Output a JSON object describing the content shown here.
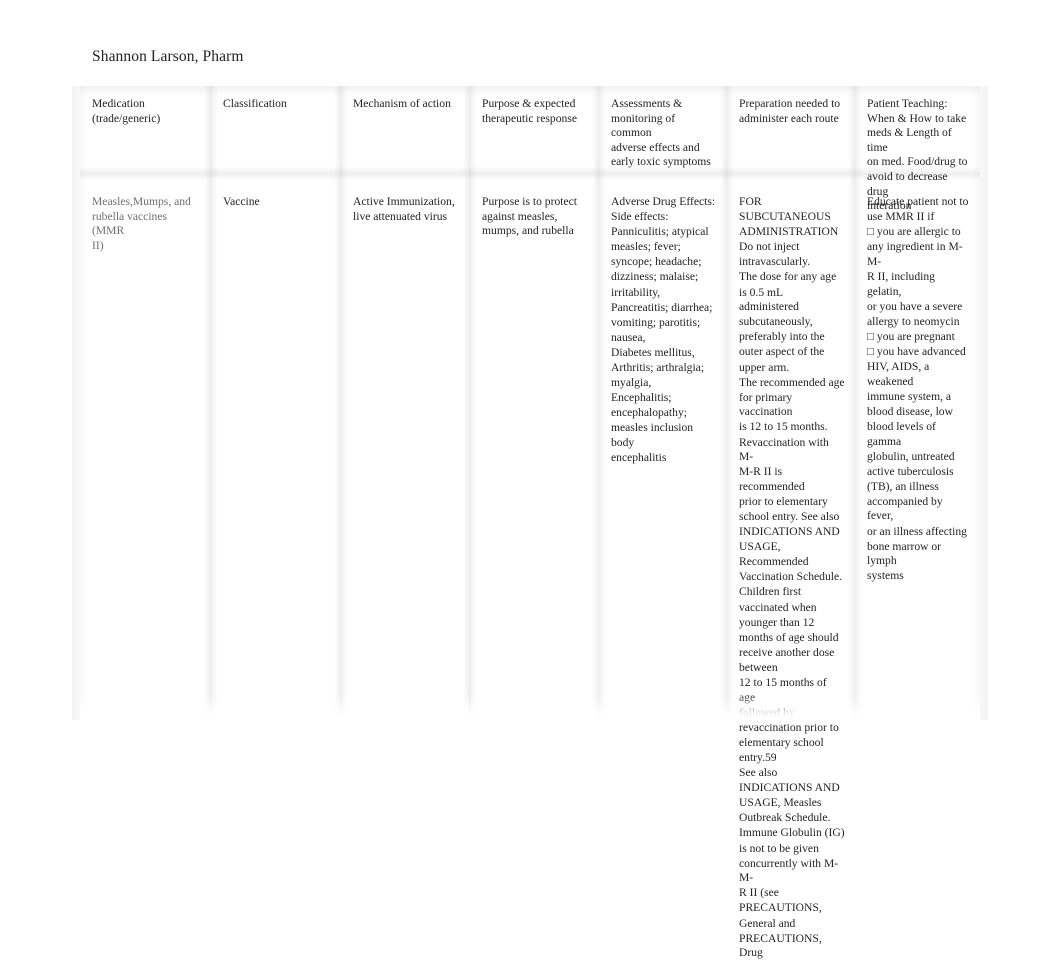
{
  "document": {
    "author_line": "Shannon Larson, Pharm"
  },
  "table": {
    "columns": [
      {
        "id": "medication",
        "header": "Medication\n(trade/generic)"
      },
      {
        "id": "classification",
        "header": "Classification"
      },
      {
        "id": "mechanism",
        "header": "Mechanism of action"
      },
      {
        "id": "purpose",
        "header": "Purpose & expected\ntherapeutic response"
      },
      {
        "id": "assessments",
        "header": "Assessments &\nmonitoring of common\nadverse effects and\nearly toxic symptoms"
      },
      {
        "id": "preparation",
        "header": "Preparation needed to\nadminister each route"
      },
      {
        "id": "teaching",
        "header": "Patient Teaching:\nWhen & How to take\nmeds & Length of time\non med. Food/drug to\navoid to decrease drug\ninteration"
      }
    ],
    "rows": [
      {
        "medication": "Measles,Mumps, and\nrubella vaccines (MMR\nII)",
        "classification": "Vaccine",
        "mechanism": "Active Immunization,\nlive attenuated virus",
        "purpose": "Purpose is to   protect\nagainst measles,\nmumps, and rubella",
        "assessments_blocks": [
          "Adverse Drug Effects:",
          "Side effects:",
          "Panniculitis; atypical",
          "measles; fever;",
          "syncope; headache;",
          "dizziness; malaise;",
          "irritability,",
          "Pancreatitis; diarrhea;",
          "vomiting; parotitis;",
          "nausea,",
          "Diabetes mellitus,",
          "Arthritis; arthralgia;",
          "myalgia,",
          "Encephalitis;",
          "encephalopathy;",
          "measles inclusion body",
          "encephalitis"
        ],
        "preparation_blocks": [
          "FOR",
          "SUBCUTANEOUS",
          "ADMINISTRATION",
          "Do not inject",
          "intravascularly.",
          "The dose for any age",
          "is 0.5 mL administered",
          "subcutaneously,",
          "preferably into the",
          "outer aspect of the",
          "upper arm.",
          "The recommended age",
          "for primary vaccination",
          "is 12 to 15 months.",
          "Revaccination with M-",
          "M-R II is recommended",
          "prior to elementary",
          "school entry. See also",
          "INDICATIONS AND",
          "USAGE,",
          "Recommended",
          "Vaccination Schedule.",
          "Children first",
          "vaccinated when",
          "younger than 12",
          "months of age should",
          "receive another dose",
          "between",
          "12 to 15 months of age",
          "followed by",
          "revaccination prior to",
          "elementary school",
          "entry.59",
          " See also",
          "INDICATIONS AND",
          "USAGE, Measles",
          "Outbreak Schedule.",
          "Immune Globulin (IG)",
          "is not to be given",
          "concurrently with M-M-",
          "R II (see",
          "PRECAUTIONS,",
          "General and",
          "PRECAUTIONS, Drug"
        ],
        "teaching_blocks": [
          "Educate patient not to",
          "use MMR II if",
          "□ you are allergic to",
          "any ingredient in M-M-",
          "R II, including gelatin,",
          "or you have a severe",
          "allergy to neomycin",
          "□  you are pregnant",
          "□  you have advanced",
          "HIV, AIDS, a weakened",
          "immune system, a",
          "blood disease, low",
          "blood levels of gamma",
          "globulin, untreated",
          "active tuberculosis",
          "(TB), an illness",
          "accompanied by fever,",
          "or an illness affecting",
          "bone marrow or lymph",
          "systems"
        ]
      }
    ]
  },
  "style": {
    "text_color": "#231f20",
    "muted_text_color": "#6f6f72",
    "page_background": "#ffffff"
  }
}
